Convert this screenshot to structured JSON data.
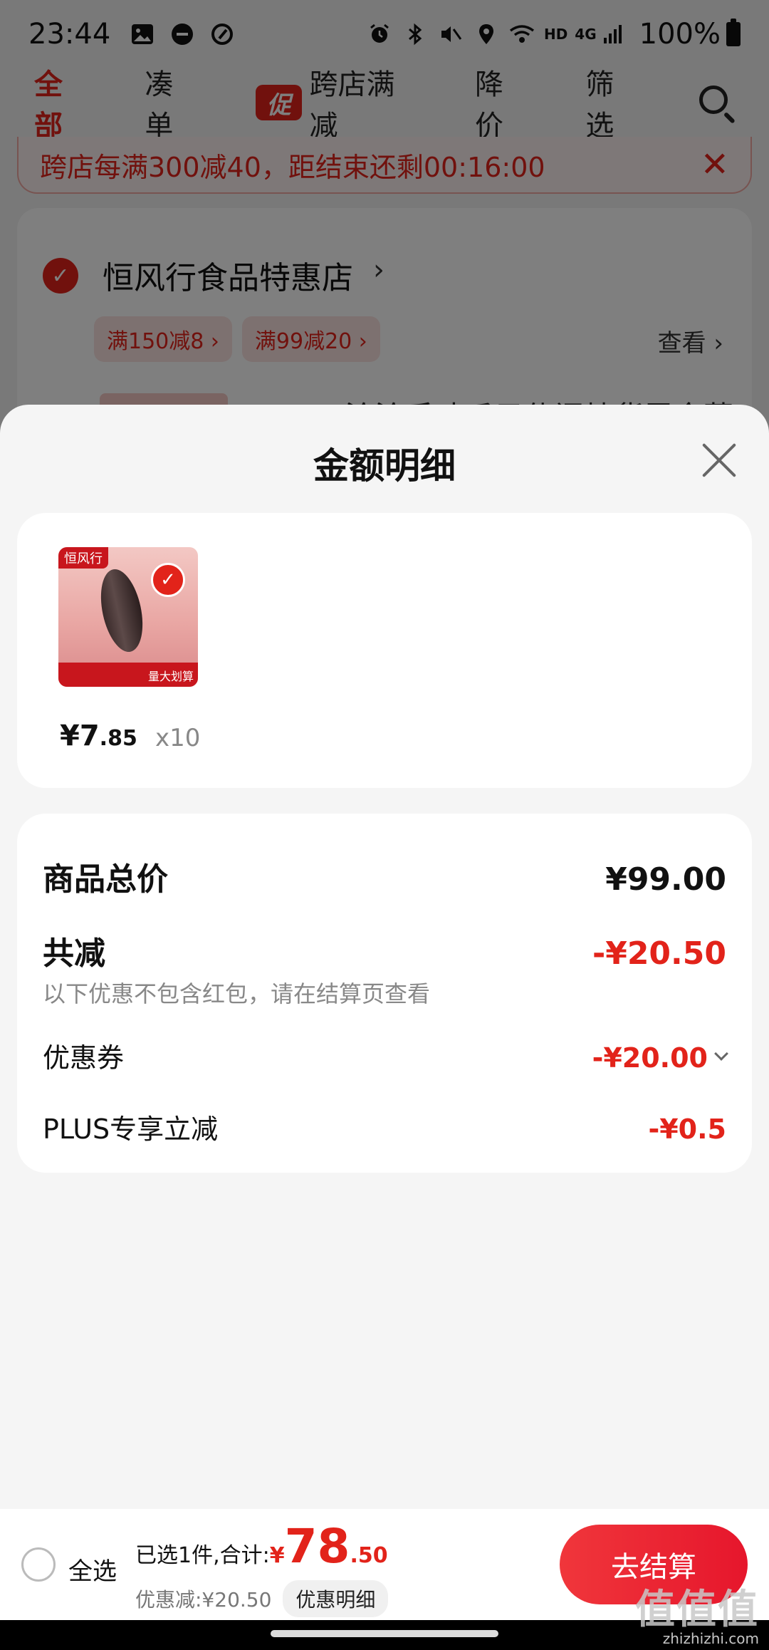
{
  "status_bar": {
    "time": "23:44",
    "network": "4G",
    "hd": "HD",
    "battery": "100%"
  },
  "tabs": [
    {
      "label": "全部",
      "active": true
    },
    {
      "label": "凑单",
      "active": false
    },
    {
      "label": "跨店满减",
      "active": false,
      "badge": "促"
    },
    {
      "label": "降价",
      "active": false
    },
    {
      "label": "筛选",
      "active": false
    }
  ],
  "notice": {
    "text": "跨店每满300减40，距结束还剩00:16:00",
    "close": "✕"
  },
  "shop": {
    "name": "恒风行食品特惠店",
    "tags": [
      "满150减8 ›",
      "满99减20 ›"
    ],
    "view_label": "查看 ›",
    "product_title_partial": "洽洽手味瓜子休闲炒货零食薯"
  },
  "sheet": {
    "title": "金额明细",
    "product": {
      "brand": "恒风行",
      "price_int": "¥7",
      "price_dec": ".85",
      "qty": "x10",
      "image_label": "量大划算"
    },
    "total_label": "商品总价",
    "total_value": "¥99.00",
    "reduce_label": "共减",
    "reduce_value": "-¥20.50",
    "reduce_note": "以下优惠不包含红包，请在结算页查看",
    "coupon_label": "优惠券",
    "coupon_value": "-¥20.00",
    "plus_label": "PLUS专享立减",
    "plus_value": "-¥0.5"
  },
  "checkout": {
    "select_all": "全选",
    "summary_label": "已选1件,合计:",
    "summary_yen": "¥",
    "summary_int": "78",
    "summary_dec": ".50",
    "discount_text": "优惠减:¥20.50",
    "detail_chip": "优惠明细",
    "checkout_button": "去结算"
  },
  "watermark": {
    "mark": "值值值",
    "url": "zhizhizhi.com"
  },
  "colors": {
    "accent": "#e2231a",
    "sheet_bg": "#f5f5f5",
    "card_bg": "#ffffff"
  }
}
